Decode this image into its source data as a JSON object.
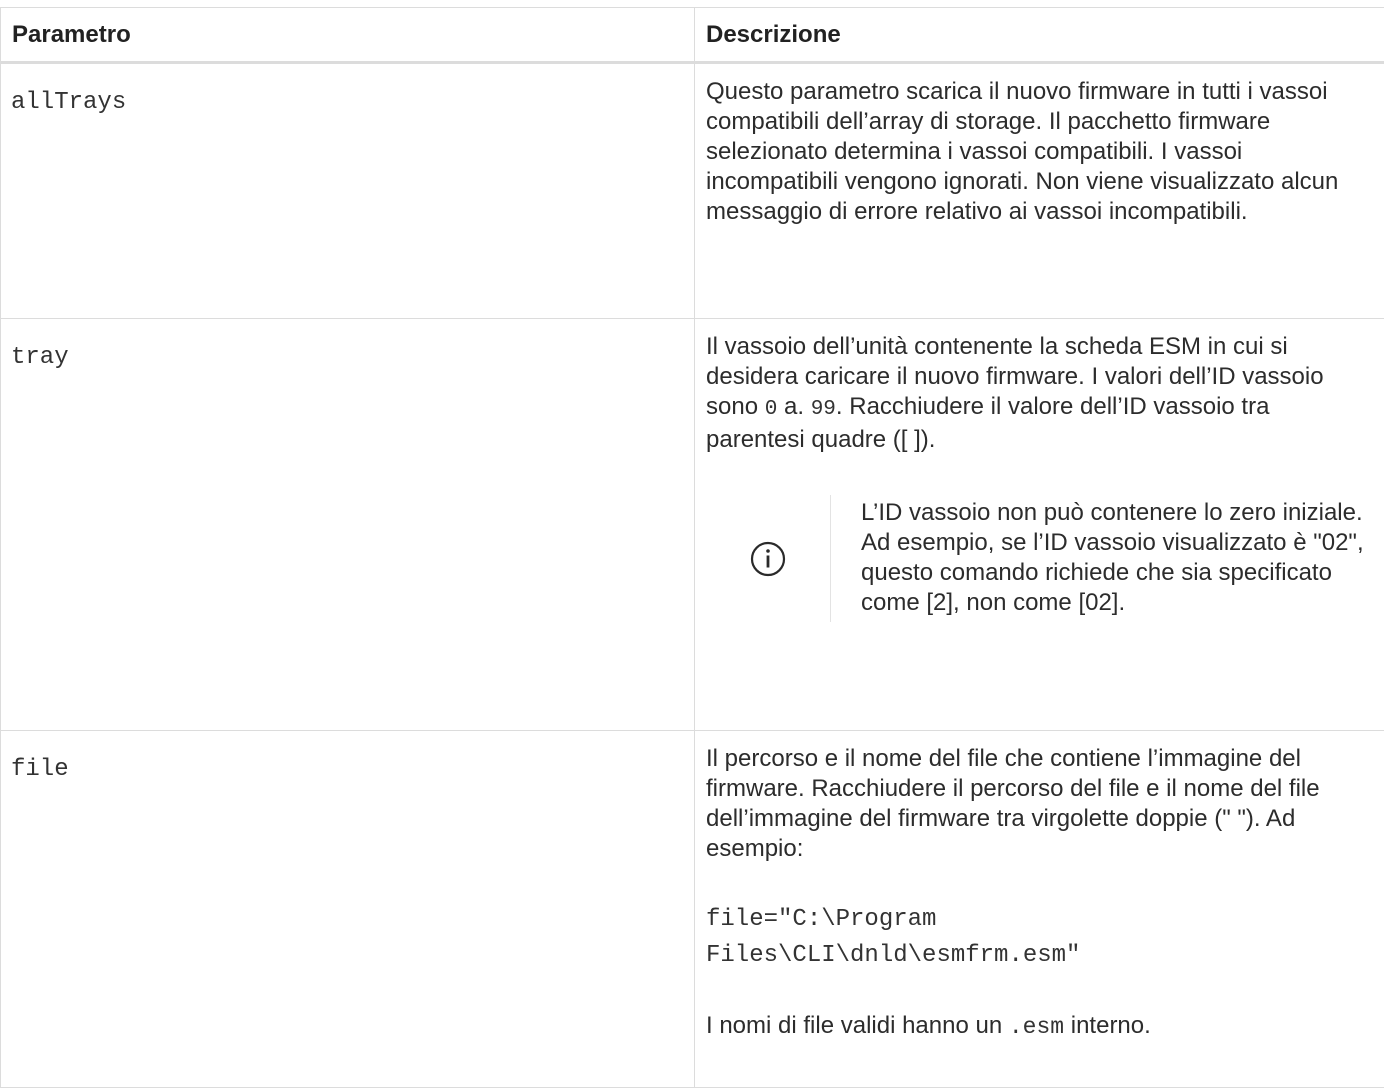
{
  "table": {
    "headers": [
      "Parametro",
      "Descrizione"
    ],
    "rows": [
      {
        "param": "allTrays",
        "desc": "Questo parametro scarica il nuovo firmware in tutti i vassoi compatibili dell’array di storage. Il pacchetto firmware selezionato determina i vassoi compatibili. I vassoi incompatibili vengono ignorati. Non viene visualizzato alcun messaggio di errore relativo ai vassoi incompatibili."
      },
      {
        "param": "tray",
        "desc_part1": "Il vassoio dell’unità contenente la scheda ESM in cui si desidera caricare il nuovo firmware. I valori dell’ID vassoio sono ",
        "code1": "0",
        "desc_part2": " a. ",
        "code2": "99",
        "desc_part3": ". Racchiudere il valore dell’ID vassoio tra parentesi quadre ([ ]).",
        "note": {
          "icon": "info-icon",
          "text": "L’ID vassoio non può contenere lo zero iniziale. Ad esempio, se l’ID vassoio visualizzato è \"02\", questo comando richiede che sia specificato come [2], non come [02]."
        }
      },
      {
        "param": "file",
        "desc": "Il percorso e il nome del file che contiene l’immagine del firmware. Racchiudere il percorso del file e il nome del file dell’immagine del firmware tra virgolette doppie (\" \"). Ad esempio:",
        "code_line1": "file=\"C:\\Program",
        "code_line2": "Files\\CLI\\dnld\\esmfrm.esm\"",
        "after_part1": "I nomi di file validi hanno un ",
        "after_code": ".esm",
        "after_part2": " interno."
      }
    ]
  },
  "colors": {
    "border": "#dcdcdc",
    "text": "#2c2c2c",
    "icon": "#2a2a2a"
  }
}
